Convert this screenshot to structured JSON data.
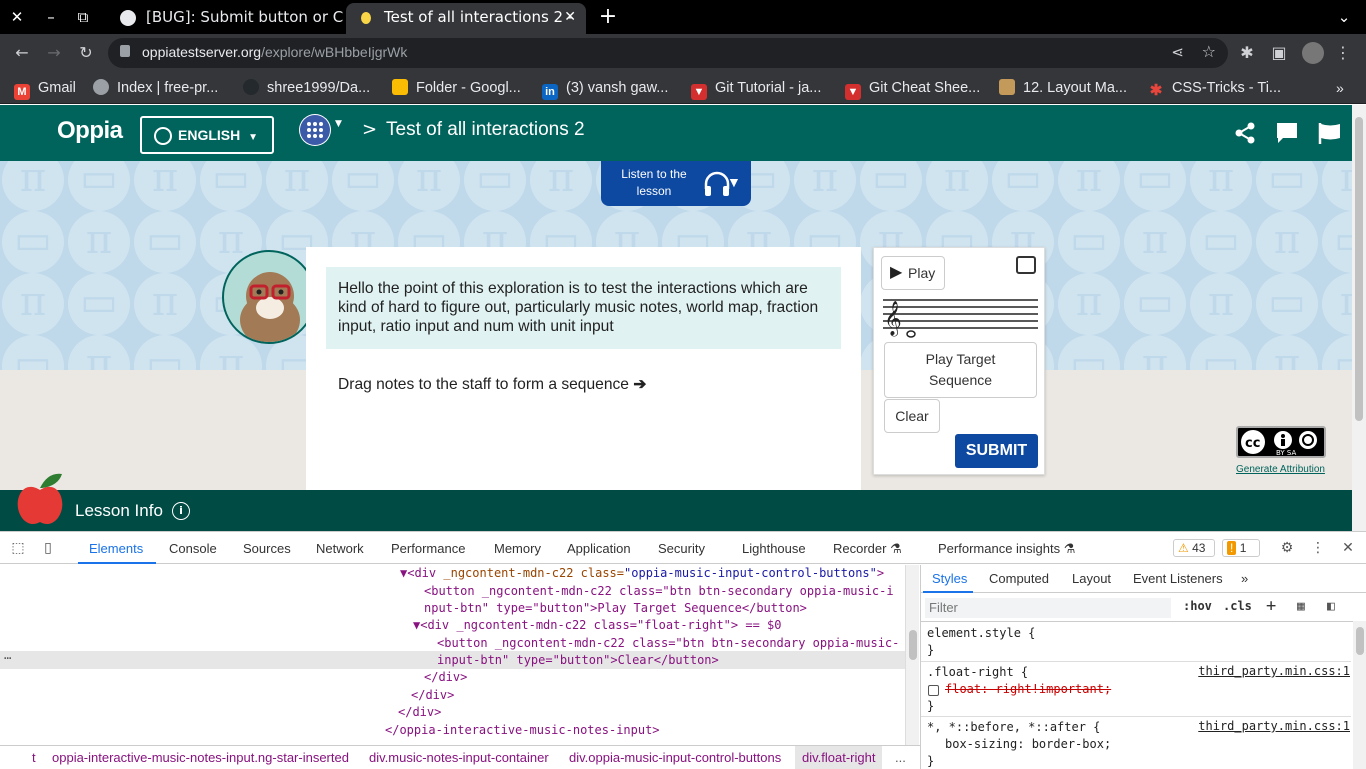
{
  "browser": {
    "tabs": [
      {
        "title": "[BUG]: Submit button or C"
      },
      {
        "title": "Test of all interactions 2 -"
      }
    ],
    "url": {
      "host": "oppiatestserver.org",
      "path": "/explore/wBHbbeIjgrWk"
    },
    "bookmarks": [
      {
        "label": "Gmail",
        "icon": "gmail-icon",
        "color": "#ea4335"
      },
      {
        "label": "Index | free-pr...",
        "icon": "globe-icon",
        "color": "#9aa0a6"
      },
      {
        "label": "shree1999/Da...",
        "icon": "github-icon",
        "color": "#24292e"
      },
      {
        "label": "Folder - Googl...",
        "icon": "drive-icon",
        "color": "#fbbc04"
      },
      {
        "label": "(3) vansh gaw...",
        "icon": "linkedin-icon",
        "color": "#0a66c2"
      },
      {
        "label": "Git Tutorial - ja...",
        "icon": "javatpoint-icon",
        "color": "#d32f2f"
      },
      {
        "label": "Git Cheat Shee...",
        "icon": "javatpoint-icon",
        "color": "#d32f2f"
      },
      {
        "label": "12. Layout Ma...",
        "icon": "book-icon",
        "color": "#c49a5a"
      },
      {
        "label": "CSS-Tricks - Ti...",
        "icon": "star-icon",
        "color": "#e8453c"
      }
    ]
  },
  "oppia": {
    "logo": "Oppia",
    "language": "ENGLISH",
    "breadcrumb_sep": ">",
    "title": "Test of all interactions 2",
    "audio_label": "Listen to the lesson",
    "content": "Hello the point of this exploration is to test the interactions which are kind of hard to figure out, particularly music notes, world map, fraction input, ratio input and num with unit input",
    "instruction": "Drag notes to the staff to form a sequence",
    "play_label": "Play",
    "play_target_label": "Play Target Sequence",
    "clear_label": "Clear",
    "submit_label": "SUBMIT",
    "generate_attribution": "Generate Attribution",
    "cc_text": "BY  SA",
    "lesson_info": "Lesson Info",
    "brand_color": "#00645c",
    "accent_color": "#0d48a1"
  },
  "devtools": {
    "tabs": [
      "Elements",
      "Console",
      "Sources",
      "Network",
      "Performance",
      "Memory",
      "Application",
      "Security",
      "Lighthouse",
      "Recorder",
      "Performance insights"
    ],
    "warnings": "43",
    "issues": "1",
    "dom_lines": [
      {
        "indent": "",
        "tag": "<div",
        "attr": "_ngcontent-mdn-c22",
        "cls": "class=",
        "val": "\"oppia-music-input-control-buttons\"",
        "end": ">"
      },
      {
        "text": "<button _ngcontent-mdn-c22 class=\"btn btn-secondary oppia-music-i"
      },
      {
        "text": "nput-btn\" type=\"button\">Play Target Sequence</button>"
      },
      {
        "text": "<div _ngcontent-mdn-c22 class=\"float-right\"> == $0"
      },
      {
        "text": "<button _ngcontent-mdn-c22 class=\"btn btn-secondary oppia-music-"
      },
      {
        "text": "input-btn\" type=\"button\">Clear</button>"
      },
      {
        "text": "</div>"
      },
      {
        "text": "</div>"
      },
      {
        "text": "</div>"
      },
      {
        "text": "</oppia-interactive-music-notes-input>"
      }
    ],
    "breadcrumbs": [
      "t",
      "oppia-interactive-music-notes-input.ng-star-inserted",
      "div.music-notes-input-container",
      "div.oppia-music-input-control-buttons",
      "div.float-right",
      "..."
    ],
    "styles_tabs": [
      "Styles",
      "Computed",
      "Layout",
      "Event Listeners"
    ],
    "filter_placeholder": "Filter",
    "hov": ":hov",
    "cls": ".cls",
    "rules": [
      {
        "selector": "element.style {",
        "close": "}"
      },
      {
        "selector": ".float-right {",
        "prop": "float: right!important;",
        "source": "third_party.min.css:1",
        "close": "}"
      },
      {
        "selector": "*, *::before, *::after {",
        "prop": "box-sizing: border-box;",
        "source": "third_party.min.css:1",
        "close": "}"
      }
    ]
  }
}
